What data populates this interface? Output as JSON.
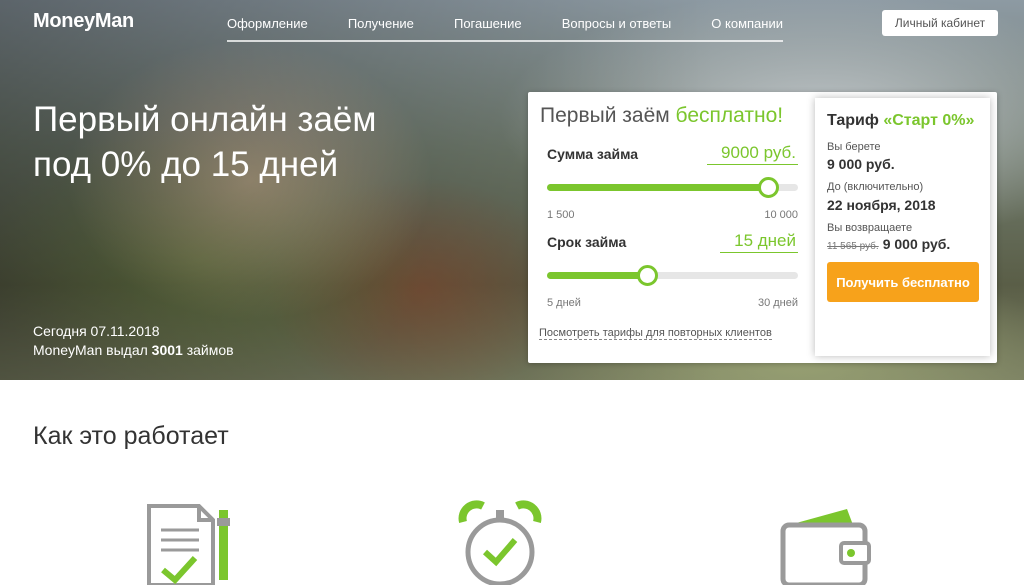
{
  "header": {
    "logo": "MoneyMan",
    "nav": [
      "Оформление",
      "Получение",
      "Погашение",
      "Вопросы и ответы",
      "О компании"
    ],
    "cabinet_button": "Личный кабинет"
  },
  "hero": {
    "title_line1": "Первый онлайн заём",
    "title_line2": "под 0% до 15 дней",
    "stats_line1": "Сегодня 07.11.2018",
    "stats_prefix": "MoneyMan выдал",
    "stats_count": "3001",
    "stats_suffix": "займов"
  },
  "calculator": {
    "title_main": "Первый заём",
    "title_accent": "бесплатно!",
    "amount": {
      "label": "Сумма займа",
      "value": "9000 руб.",
      "min_label": "1 500",
      "max_label": "10 000",
      "min": 1500,
      "max": 10000,
      "current": 9000
    },
    "term": {
      "label": "Срок займа",
      "value": "15 дней",
      "min_label": "5 дней",
      "max_label": "30 дней",
      "min": 5,
      "max": 30,
      "current": 15
    },
    "repeat_link": "Посмотреть тарифы для повторных клиентов"
  },
  "tariff": {
    "title_prefix": "Тариф",
    "title_accent": "«Старт 0%»",
    "take_label": "Вы берете",
    "take_value": "9 000 руб.",
    "until_label": "До (включительно)",
    "until_value": "22 ноября, 2018",
    "return_label": "Вы возвращаете",
    "return_old": "11 565 руб.",
    "return_value": "9 000 руб.",
    "button": "Получить бесплатно"
  },
  "how": {
    "title": "Как это работает"
  },
  "colors": {
    "accent_green": "#7bc62d",
    "button_orange": "#f7a21b"
  }
}
